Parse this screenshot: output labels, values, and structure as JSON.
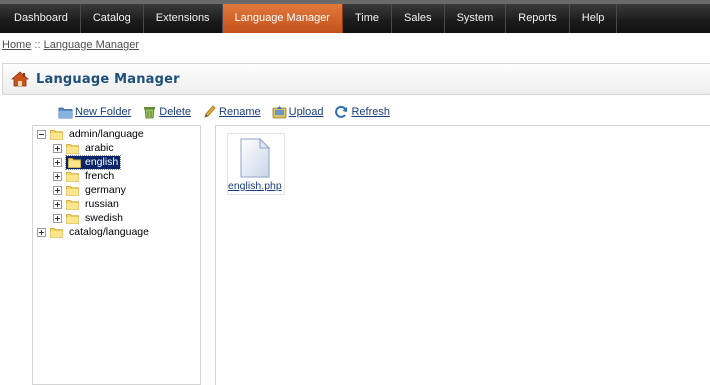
{
  "nav": {
    "items": [
      {
        "label": "Dashboard"
      },
      {
        "label": "Catalog"
      },
      {
        "label": "Extensions"
      },
      {
        "label": "Language Manager",
        "active": true
      },
      {
        "label": "Time"
      },
      {
        "label": "Sales"
      },
      {
        "label": "System"
      },
      {
        "label": "Reports"
      },
      {
        "label": "Help"
      }
    ]
  },
  "breadcrumb": {
    "home": "Home",
    "separator": " :: ",
    "current": "Language Manager"
  },
  "heading": {
    "title": "Language Manager",
    "icon": "home-icon"
  },
  "toolbar": {
    "new_folder": "New Folder",
    "delete": "Delete",
    "rename": "Rename",
    "upload": "Upload",
    "refresh": "Refresh"
  },
  "tree": {
    "root1": "admin/language",
    "children": [
      "arabic",
      "english",
      "french",
      "germany",
      "russian",
      "swedish"
    ],
    "selected": "english",
    "root2": "catalog/language"
  },
  "files": [
    {
      "name": "english.php",
      "icon": "document-icon"
    }
  ],
  "colors": {
    "active_tab": "#c9591f",
    "link": "#1a3d7c",
    "title": "#1d4f7a",
    "selected_bg": "#0a246a"
  }
}
